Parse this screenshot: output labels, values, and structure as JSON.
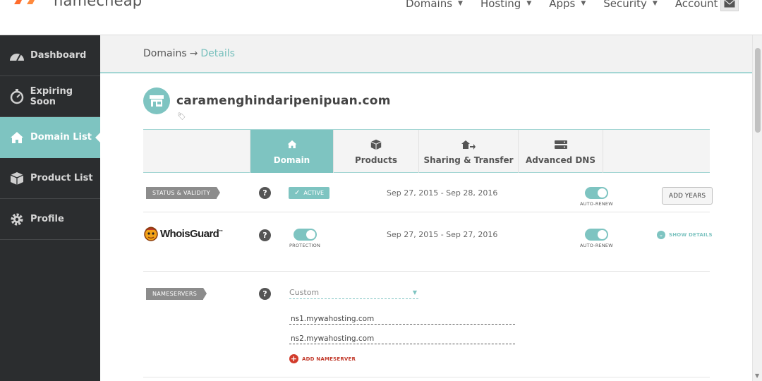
{
  "brand": {
    "name": "namecheap",
    "accent": "#7ec4c1",
    "logo_color": "#ff6c2c"
  },
  "topnav": {
    "items": [
      {
        "label": "Domains"
      },
      {
        "label": "Hosting"
      },
      {
        "label": "Apps"
      },
      {
        "label": "Security"
      },
      {
        "label": "Account"
      }
    ],
    "mail_icon": "envelope-icon"
  },
  "sidebar": {
    "items": [
      {
        "label": "Dashboard",
        "icon": "speedometer-icon"
      },
      {
        "label": "Expiring Soon",
        "icon": "stopwatch-icon"
      },
      {
        "label": "Domain List",
        "icon": "home-icon",
        "active": true
      },
      {
        "label": "Product List",
        "icon": "box-icon"
      },
      {
        "label": "Profile",
        "icon": "gear-icon"
      }
    ]
  },
  "breadcrumb": {
    "root": "Domains",
    "arrow": "→",
    "current": "Details"
  },
  "domain": {
    "name": "caramenghindaripenipuan.com",
    "icon": "store-icon"
  },
  "tabs": [
    {
      "label": "Domain",
      "icon": "home-icon",
      "active": true
    },
    {
      "label": "Products",
      "icon": "box-icon"
    },
    {
      "label": "Sharing & Transfer",
      "icon": "share-icon"
    },
    {
      "label": "Advanced DNS",
      "icon": "server-icon"
    }
  ],
  "status_row": {
    "label": "STATUS & VALIDITY",
    "help": "?",
    "status": "ACTIVE",
    "dates": "Sep 27, 2015 - Sep 28, 2016",
    "autorenew_caption": "AUTO-RENEW",
    "autorenew_on": true,
    "add_years": "ADD YEARS"
  },
  "whoisguard_row": {
    "logo_text": "WhoisGuard",
    "logo_tm": "™",
    "help": "?",
    "protection_caption": "PROTECTION",
    "protection_on": true,
    "dates": "Sep 27, 2015 - Sep 27, 2016",
    "autorenew_caption": "AUTO-RENEW",
    "autorenew_on": true,
    "show_details": "SHOW DETAILS"
  },
  "nameservers_row": {
    "label": "NAMESERVERS",
    "help": "?",
    "mode": "Custom",
    "servers": [
      "ns1.mywahosting.com",
      "ns2.mywahosting.com"
    ],
    "add_label": "ADD NAMESERVER"
  }
}
